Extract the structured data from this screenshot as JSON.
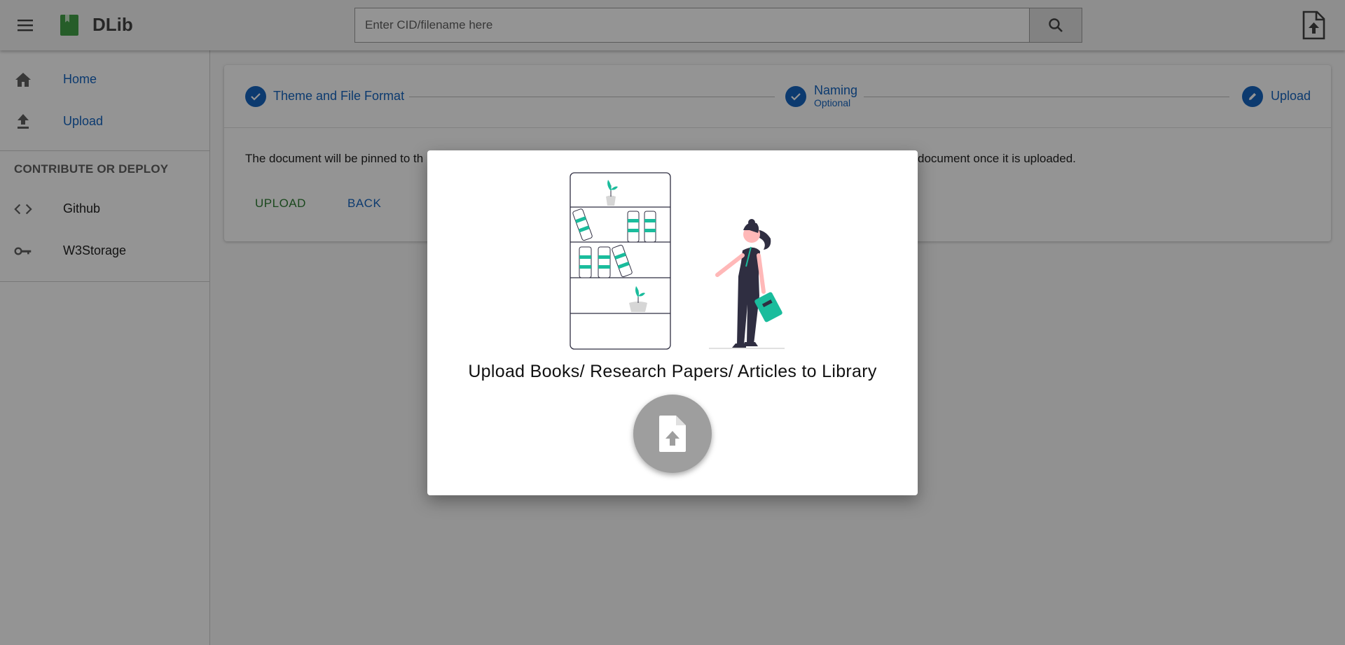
{
  "header": {
    "brand": "DLib",
    "search_placeholder": "Enter CID/filename here"
  },
  "sidebar": {
    "items": [
      {
        "label": "Home",
        "icon": "home-icon"
      },
      {
        "label": "Upload",
        "icon": "upload-icon"
      }
    ],
    "section_title": "CONTRIBUTE OR DEPLOY",
    "section_items": [
      {
        "label": "Github",
        "icon": "code-icon"
      },
      {
        "label": "W3Storage",
        "icon": "key-icon"
      }
    ]
  },
  "stepper": {
    "steps": [
      {
        "label": "Theme and File Format",
        "state": "completed"
      },
      {
        "label": "Naming",
        "sublabel": "Optional",
        "state": "completed"
      },
      {
        "label": "Upload",
        "state": "active"
      }
    ]
  },
  "card": {
    "text_left": "The document will be pinned to th",
    "text_right": "document once it is uploaded.",
    "upload_label": "UPLOAD",
    "back_label": "BACK"
  },
  "dialog": {
    "title": "Upload Books/ Research Papers/ Articles to Library",
    "button_icon": "file-upload-icon"
  },
  "colors": {
    "primary": "#1565c0",
    "success": "#2e7d32",
    "brand_green": "#43a047",
    "accent_teal": "#1abc9c"
  }
}
